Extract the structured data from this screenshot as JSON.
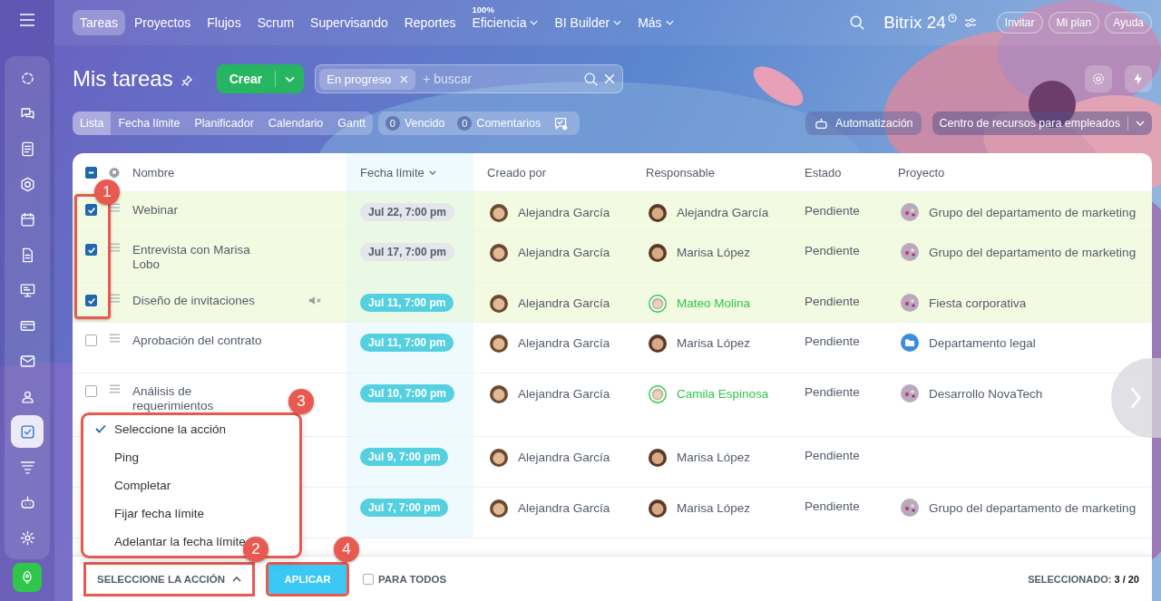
{
  "top_nav": {
    "items": [
      {
        "label": "Tareas",
        "selected": true,
        "dropdown": false
      },
      {
        "label": "Proyectos",
        "selected": false,
        "dropdown": false
      },
      {
        "label": "Flujos",
        "selected": false,
        "dropdown": false
      },
      {
        "label": "Scrum",
        "selected": false,
        "dropdown": false
      },
      {
        "label": "Supervisando",
        "selected": false,
        "dropdown": false
      },
      {
        "label": "Reportes",
        "selected": false,
        "dropdown": false
      },
      {
        "label": "Eficiencia",
        "selected": false,
        "dropdown": true,
        "badge": "100%"
      },
      {
        "label": "BI Builder",
        "selected": false,
        "dropdown": true
      },
      {
        "label": "Más",
        "selected": false,
        "dropdown": true
      }
    ],
    "logo": "Bitrix 24",
    "buttons": [
      "Invitar",
      "Mi plan",
      "Ayuda"
    ]
  },
  "sidebar": {
    "items": [
      {
        "selected": false
      },
      {
        "selected": false
      },
      {
        "selected": false
      },
      {
        "selected": false
      },
      {
        "selected": false
      },
      {
        "selected": false
      },
      {
        "selected": false
      },
      {
        "selected": false
      },
      {
        "selected": false
      },
      {
        "selected": false
      },
      {
        "selected": true
      },
      {
        "selected": false
      },
      {
        "selected": false
      },
      {
        "selected": false
      }
    ]
  },
  "page": {
    "title": "Mis tareas",
    "create_button": "Crear",
    "filter": {
      "chip": "En progreso",
      "placeholder": "+ buscar"
    }
  },
  "view_tabs": [
    {
      "label": "Lista",
      "selected": true
    },
    {
      "label": "Fecha límite",
      "selected": false
    },
    {
      "label": "Planificador",
      "selected": false
    },
    {
      "label": "Calendario",
      "selected": false
    },
    {
      "label": "Gantt",
      "selected": false
    }
  ],
  "counters": [
    {
      "count": "0",
      "label": "Vencido"
    },
    {
      "count": "0",
      "label": "Comentarios"
    }
  ],
  "automation_button": "Automatización",
  "resource_select": "Centro de recursos para empleados",
  "table": {
    "header_partial": true,
    "columns": [
      {
        "label": "Nombre",
        "sorted": false
      },
      {
        "label": "Fecha límite",
        "sorted": true
      },
      {
        "label": "Creado por",
        "sorted": false
      },
      {
        "label": "Responsable",
        "sorted": false
      },
      {
        "label": "Estado",
        "sorted": false
      },
      {
        "label": "Proyecto",
        "sorted": false
      }
    ],
    "rows": [
      {
        "selected": true,
        "name": "Webinar",
        "muted": false,
        "deadline": {
          "text": "Jul 22, 7:00 pm",
          "kind": "later"
        },
        "creator": "Alejandra García",
        "responsible": "Alejandra García",
        "responsible_highlighted": false,
        "status": "Pendiente",
        "project": {
          "name": "Grupo del departamento de marketing"
        }
      },
      {
        "selected": true,
        "name": "Entrevista con Marisa Lobo",
        "muted": false,
        "deadline": {
          "text": "Jul 17, 7:00 pm",
          "kind": "later"
        },
        "creator": "Alejandra García",
        "responsible": "Marisa López",
        "responsible_highlighted": false,
        "status": "Pendiente",
        "project": {
          "name": "Grupo del departamento de marketing"
        }
      },
      {
        "selected": true,
        "name": "Diseño de invitaciones",
        "muted": true,
        "deadline": {
          "text": "Jul 11, 7:00 pm",
          "kind": "soon"
        },
        "creator": "Alejandra García",
        "responsible": "Mateo Molina",
        "responsible_highlighted": true,
        "status": "Pendiente",
        "project": {
          "name": "Fiesta corporativa"
        }
      },
      {
        "selected": false,
        "name": "Aprobación del contrato",
        "muted": false,
        "deadline": {
          "text": "Jul 11, 7:00 pm",
          "kind": "soon"
        },
        "creator": "Alejandra García",
        "responsible": "Marisa López",
        "responsible_highlighted": false,
        "status": "Pendiente",
        "project": {
          "name": "Departamento legal",
          "kind": "folder"
        }
      },
      {
        "selected": false,
        "name": "Análisis de requerimientos",
        "muted": false,
        "deadline": {
          "text": "Jul 10, 7:00 pm",
          "kind": "soon"
        },
        "creator": "Alejandra García",
        "responsible": "Camila Espinosa",
        "responsible_highlighted": true,
        "status": "Pendiente",
        "project": {
          "name": "Desarrollo NovaTech"
        }
      },
      {
        "selected": false,
        "deadline": {
          "text": "Jul 9, 7:00 pm",
          "kind": "soon"
        },
        "creator": "Alejandra García",
        "responsible": "Marisa López",
        "responsible_highlighted": false,
        "status": "Pendiente"
      },
      {
        "selected": false,
        "deadline": {
          "text": "Jul 7, 7:00 pm",
          "kind": "soon"
        },
        "creator": "Alejandra García",
        "responsible": "Marisa López",
        "responsible_highlighted": false,
        "status": "Pendiente",
        "project": {
          "name": "Grupo del departamento de marketing"
        }
      }
    ]
  },
  "action_menu": {
    "items": [
      {
        "label": "Seleccione la acción",
        "selected": true
      },
      {
        "label": "Ping",
        "selected": false
      },
      {
        "label": "Completar",
        "selected": false
      },
      {
        "label": "Fijar fecha límite",
        "selected": false
      },
      {
        "label": "Adelantar la fecha límite",
        "selected": false
      }
    ]
  },
  "footer": {
    "action_select": "SELECCIONE LA ACCIÓN",
    "apply_button": "APLICAR",
    "for_all": {
      "label": "PARA TODOS",
      "checked": false
    },
    "selected_label": "SELECCIONADO:",
    "selected_count": "3 / 20"
  },
  "callouts": [
    {
      "number": "1"
    },
    {
      "number": "2"
    },
    {
      "number": "3"
    },
    {
      "number": "4"
    }
  ]
}
